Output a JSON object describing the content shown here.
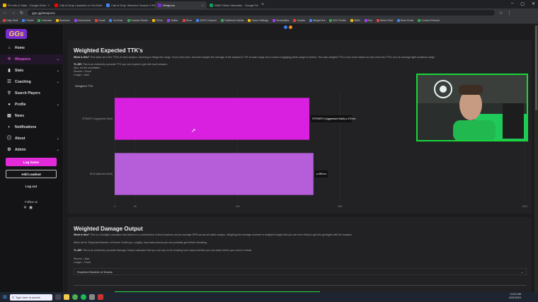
{
  "tabs": [
    {
      "label": "Fix Info & Stats - Google Drive",
      "color": "#f4b400"
    },
    {
      "label": "Call of Duty Loadouts on YouTube",
      "color": "#ff0000"
    },
    {
      "label": "Call of Duty: Warzone Season 3 Re...",
      "color": "#4285f4"
    },
    {
      "label": "Weapons",
      "color": "#7a2ccf",
      "active": true
    },
    {
      "label": "WMG Meta Calculator - Google Sh...",
      "color": "#0f9d58"
    }
  ],
  "url": "ggs.gg/weapons",
  "bookmarks": [
    "Daily Stuff",
    "FriWell",
    "Calendar",
    "Business",
    "Overlooked",
    "Gmail",
    "YouTube",
    "Youtube Studio",
    "TikTok",
    "Twitter",
    "Drive",
    "ZAPS Channel",
    "TestBench Media",
    "Game Settings",
    "Streamlabs",
    "Socials",
    "Weight Bot",
    "BO2 Profile",
    "WMB",
    "Sub",
    "Wired Stuff",
    "Work Email",
    "Content Planner"
  ],
  "sidebar": {
    "logo": "GGs",
    "items": [
      {
        "label": "Home",
        "icon": "home-icon",
        "glyph": "⌂",
        "chev": ""
      },
      {
        "label": "Weapons",
        "icon": "crosshair-icon",
        "glyph": "✛",
        "chev": "⌄",
        "active": true
      },
      {
        "label": "Stats",
        "icon": "chart-icon",
        "glyph": "▮",
        "chev": "⌄"
      },
      {
        "label": "Coaching",
        "icon": "coach-icon",
        "glyph": "☷",
        "chev": "⌄"
      },
      {
        "label": "Search Players",
        "icon": "search-icon",
        "glyph": "⚲",
        "chev": ""
      },
      {
        "label": "Profile",
        "icon": "user-icon",
        "glyph": "●",
        "chev": "⌄"
      },
      {
        "label": "News",
        "icon": "news-icon",
        "glyph": "▤",
        "chev": ""
      },
      {
        "label": "Notifications",
        "icon": "bell-icon",
        "glyph": "◐",
        "chev": ""
      },
      {
        "label": "About",
        "icon": "info-icon",
        "glyph": "ⓘ",
        "chev": "⌄"
      },
      {
        "label": "Admin",
        "icon": "gear-icon",
        "glyph": "⚙",
        "chev": "⌄"
      }
    ],
    "log_game": "Log Game",
    "add_loadout": "Add Loadout",
    "logout": "Log out",
    "follow_us": "Follow us"
  },
  "ttk": {
    "title": "Weighted Expected TTK's",
    "what_label": "What is this?",
    "what_text": "This takes all of the TTKs of each weapon, factoring in things like range, recoil, and more, and then weighs the average of the weapon's TTK at each range via a custom engaging points range in-meters. This also weights TTK's even more based on how close the TTK's is to an average fight locations range.",
    "tldr_label": "TL;DR:",
    "tldr_text": "This is an extremely accurate TTK you can expect to get with each weapon.",
    "note1": "Also, for the uninitiated:",
    "note2": "Shorter = Good",
    "note3": "Longer = Bad",
    "chart_label": "Weighted TTK"
  },
  "chart_data": {
    "type": "bar",
    "orientation": "horizontal",
    "categories": [
      "STRIKER 9 (Aggressive Build)",
      "MCW (Balanced Build)"
    ],
    "values": [
      475,
      485
    ],
    "data_labels": [
      "STRIKER 9 (Aggressive Build) ⌀ 475 ms",
      "⌀ 485 ms"
    ],
    "colors": [
      "#d91fe0",
      "#b65ed9"
    ],
    "ticks": [
      0,
      50,
      300,
      550,
      1000
    ],
    "xlim": [
      0,
      1000
    ],
    "grid": true
  },
  "dmg": {
    "title": "Weighted Damage Output",
    "what_label": "What is this?",
    "what_text": "This is a Gunfight calculator that factors in a combination of shot locations and an average DPM across all viable ranges. Weighing the average however is weighed tonight that you are more likely to get into gunfights with the weapon.",
    "when_text": "When set to 'Expected Number of Downs' it tells you, roughly, how many downs you can probably get before reloading.",
    "tldr_label": "TL;DR:",
    "tldr_text": "This is an extremely accurate Damage Output calculator that you can rely on for knowing how many enemies you can down before you need to reload.",
    "note1": "Shorter = Bad",
    "note2": "Longer = Good",
    "select_label": "Expected Number of Downs"
  },
  "taskbar": {
    "search_placeholder": "Type here to search",
    "time": "11:51 AM",
    "date": "4/24/2024"
  }
}
